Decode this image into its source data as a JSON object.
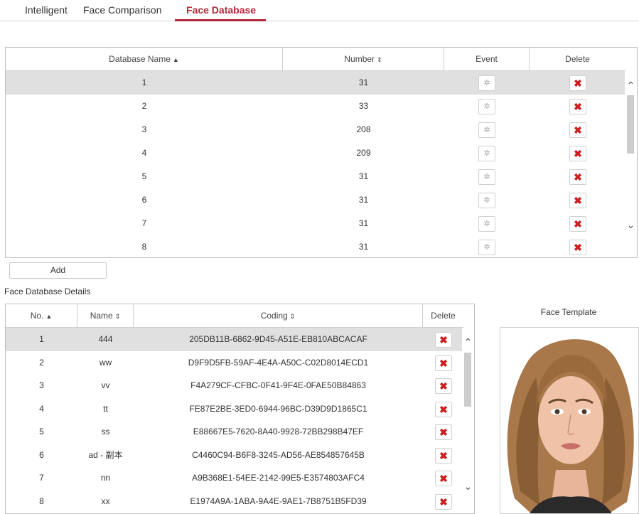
{
  "tabs": [
    {
      "label": "Intelligent"
    },
    {
      "label": "Face Comparison"
    },
    {
      "label": "Face Database"
    }
  ],
  "active_tab": "Face Database",
  "database_table": {
    "headers": {
      "name": "Database Name",
      "number": "Number",
      "event": "Event",
      "delete": "Delete"
    },
    "sort_asc_icon": "▲",
    "sort_both_icon": "⇕",
    "rows": [
      {
        "name": "1",
        "number": "31"
      },
      {
        "name": "2",
        "number": "33"
      },
      {
        "name": "3",
        "number": "208"
      },
      {
        "name": "4",
        "number": "209"
      },
      {
        "name": "5",
        "number": "31"
      },
      {
        "name": "6",
        "number": "31"
      },
      {
        "name": "7",
        "number": "31"
      },
      {
        "name": "8",
        "number": "31"
      }
    ],
    "selected_index": 0
  },
  "add_button_label": "Add",
  "details_title": "Face Database Details",
  "details_table": {
    "headers": {
      "no": "No.",
      "name": "Name",
      "coding": "Coding",
      "delete": "Delete"
    },
    "rows": [
      {
        "no": "1",
        "name": "444",
        "coding": "205DB11B-6862-9D45-A51E-EB810ABCACAF"
      },
      {
        "no": "2",
        "name": "ww",
        "coding": "D9F9D5FB-59AF-4E4A-A50C-C02D8014ECD1"
      },
      {
        "no": "3",
        "name": "vv",
        "coding": "F4A279CF-CFBC-0F41-9F4E-0FAE50B84863"
      },
      {
        "no": "4",
        "name": "tt",
        "coding": "FE87E2BE-3ED0-6944-96BC-D39D9D1865C1"
      },
      {
        "no": "5",
        "name": "ss",
        "coding": "E88667E5-7620-8A40-9928-72BB298B47EF"
      },
      {
        "no": "6",
        "name": "ad - 副本",
        "coding": "C4460C94-B6F8-3245-AD56-AE854857645B"
      },
      {
        "no": "7",
        "name": "nn",
        "coding": "A9B368E1-54EE-2142-99E5-E3574803AFC4"
      },
      {
        "no": "8",
        "name": "xx",
        "coding": "E1974A9A-1ABA-9A4E-9AE1-7B8751B5FD39"
      }
    ],
    "selected_index": 0
  },
  "face_template_title": "Face Template",
  "icons": {
    "event": "gear-icon",
    "delete": "close-icon",
    "scroll_up": "chevron-up-icon",
    "scroll_down": "chevron-down-icon"
  },
  "colors": {
    "accent": "#b5263a",
    "delete_red": "#cc1e1e",
    "selected_row": "#e0e0e0"
  }
}
